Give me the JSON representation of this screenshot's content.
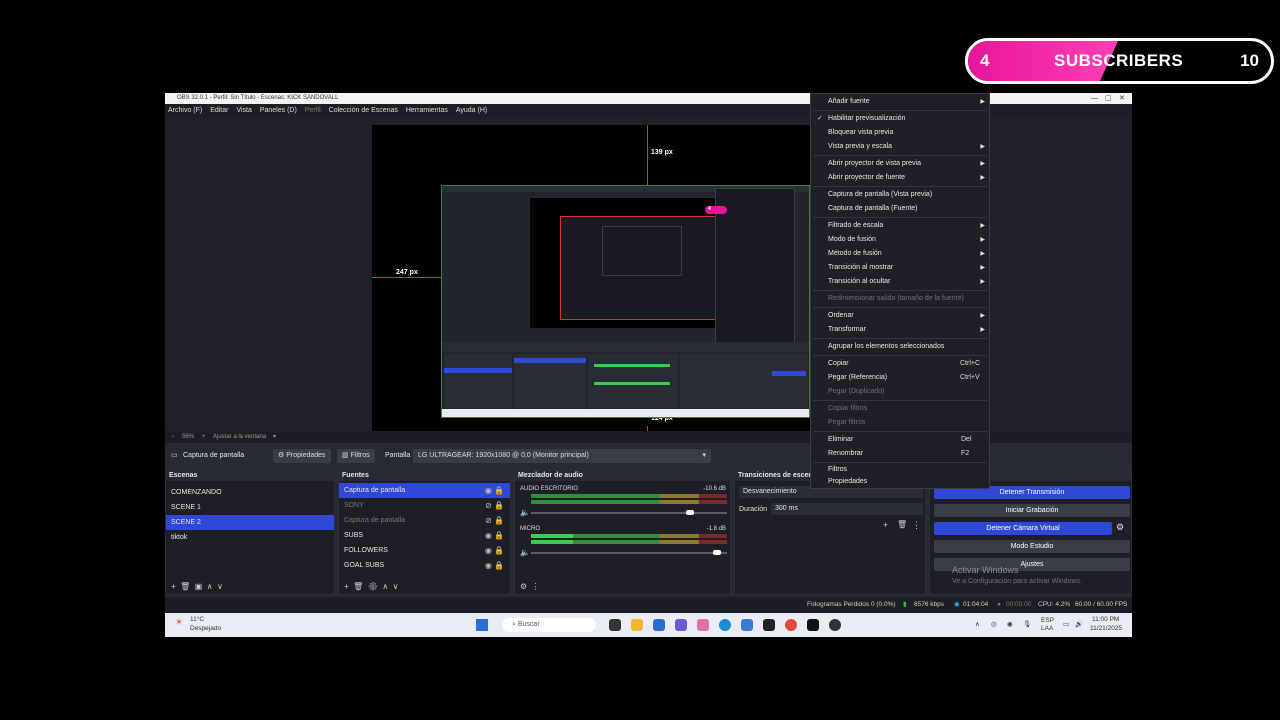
{
  "subscribers": {
    "current": "4",
    "label": "SUBSCRIBERS",
    "goal": "10",
    "colors": {
      "fill": "#e6169a",
      "border": "#ffffff"
    }
  },
  "window": {
    "title": "OBS 32.0.1 - Perfil: Sin Título - Escenas: KICK SANDOVALL",
    "menu": [
      "Archivo (F)",
      "Editar",
      "Vista",
      "Paneles (D)",
      "Perfil",
      "Colección de Escenas",
      "Herramientas",
      "Ayuda (H)"
    ],
    "controls": [
      "—",
      "▢",
      "✕"
    ]
  },
  "preview": {
    "top_px": "139 px",
    "left_px": "247 px",
    "bottom_px": "124 px",
    "mini_badge": "4"
  },
  "zoom": {
    "minus": "−",
    "value": "56%",
    "plus": "+",
    "fit_label": "Ajustar a la ventana",
    "caret": "▾"
  },
  "source_bar": {
    "source_name": "Captura de pantalla",
    "properties": "Propiedades",
    "filters": "Filtros",
    "screen_label": "Pantalla",
    "screen_value": "LG ULTRAGEAR: 1920x1080 @ 0,0 (Monitor principal)"
  },
  "scenes": {
    "title": "Escenas",
    "items": [
      {
        "label": "COMENZANDO",
        "selected": false
      },
      {
        "label": "SCENE 1",
        "selected": false
      },
      {
        "label": "SCENE 2",
        "selected": true
      },
      {
        "label": "tiktok",
        "selected": false
      }
    ],
    "footer": [
      "+",
      "🗑",
      "▣",
      "∧",
      "∨"
    ]
  },
  "sources": {
    "title": "Fuentes",
    "items": [
      {
        "label": "Captura de pantalla",
        "selected": true,
        "visible": true
      },
      {
        "label": "SONY",
        "selected": false,
        "visible": false
      },
      {
        "label": "Captura de pantalla",
        "selected": false,
        "visible": false
      },
      {
        "label": "SUBS",
        "selected": false,
        "visible": true
      },
      {
        "label": "FOLLOWERS",
        "selected": false,
        "visible": true
      },
      {
        "label": "GOAL SUBS",
        "selected": false,
        "visible": true
      }
    ],
    "footer": [
      "+",
      "🗑",
      "⚙",
      "∧",
      "∨"
    ]
  },
  "mixer": {
    "title": "Mezclador de audio",
    "channels": [
      {
        "name": "AUDIO ESCRITORIO",
        "db": "-10.6 dB",
        "level": 0,
        "volume": 0.81
      },
      {
        "name": "MICRO",
        "db": "-1.8 dB",
        "level": 0.21,
        "volume": 0.93
      }
    ],
    "scale": [
      "-60",
      "-55",
      "-50",
      "-45",
      "-40",
      "-35",
      "-30",
      "-25",
      "-20",
      "-15",
      "-10",
      "-5",
      "0"
    ]
  },
  "transitions": {
    "title": "Transiciones de escena",
    "selected": "Desvanecimiento",
    "duration_label": "Duración",
    "duration_value": "300 ms"
  },
  "controls": {
    "buttons": [
      {
        "label": "Detener Transmisión",
        "active": true
      },
      {
        "label": "Iniciar Grabación",
        "active": false
      },
      {
        "label": "Detener Cámara Virtual",
        "active": true
      },
      {
        "label": "Modo Estudio",
        "active": false
      },
      {
        "label": "Ajustes",
        "active": false
      }
    ]
  },
  "status": {
    "dropped": "Fotogramas Perdidos 0 (0.0%)",
    "bitrate": "6576 kbps",
    "stream_time": "01:04:04",
    "rec_time": "00:00:00",
    "cpu": "CPU: 4.2%",
    "fps": "60.00 / 60.00 FPS"
  },
  "activation": {
    "title": "Activar Windows",
    "subtitle": "Ve a Configuración para activar Windows."
  },
  "taskbar": {
    "weather_temp": "11°C",
    "weather_desc": "Despejado",
    "search_placeholder": "Buscar",
    "lang": "ESP",
    "lang2": "LAA",
    "time": "11:00 PM",
    "date": "11/21/2025"
  },
  "context_menu": {
    "items": [
      {
        "label": "Añadir fuente",
        "submenu": true
      },
      {
        "label": "Habilitar previsualización",
        "checked": true
      },
      {
        "label": "Bloquear vista previa"
      },
      {
        "label": "Vista previa y escala",
        "submenu": true
      },
      {
        "label": "Abrir proyector de vista previa",
        "submenu": true
      },
      {
        "label": "Abrir proyector de fuente",
        "submenu": true
      },
      {
        "label": "Captura de pantalla (Vista previa)"
      },
      {
        "label": "Captura de pantalla (Fuente)"
      },
      {
        "label": "Filtrado de escala",
        "submenu": true
      },
      {
        "label": "Modo de fusión",
        "submenu": true
      },
      {
        "label": "Método de fusión",
        "submenu": true
      },
      {
        "label": "Transición al mostrar",
        "submenu": true
      },
      {
        "label": "Transición al ocultar",
        "submenu": true
      },
      {
        "label": "Redimensionar salida (tamaño de la fuente)",
        "disabled": true
      },
      {
        "label": "Ordenar",
        "submenu": true
      },
      {
        "label": "Transformar",
        "submenu": true
      },
      {
        "label": "Agrupar los elementos seleccionados"
      },
      {
        "label": "Copiar",
        "shortcut": "Ctrl+C"
      },
      {
        "label": "Pegar (Referencia)",
        "shortcut": "Ctrl+V"
      },
      {
        "label": "Pegar (Duplicado)",
        "disabled": true
      },
      {
        "label": "Copiar filtros",
        "disabled": true
      },
      {
        "label": "Pegar filtros",
        "disabled": true
      },
      {
        "label": "Eliminar",
        "shortcut": "Del"
      },
      {
        "label": "Renombrar",
        "shortcut": "F2"
      },
      {
        "label": "Filtros"
      },
      {
        "label": "Propiedades"
      }
    ]
  }
}
